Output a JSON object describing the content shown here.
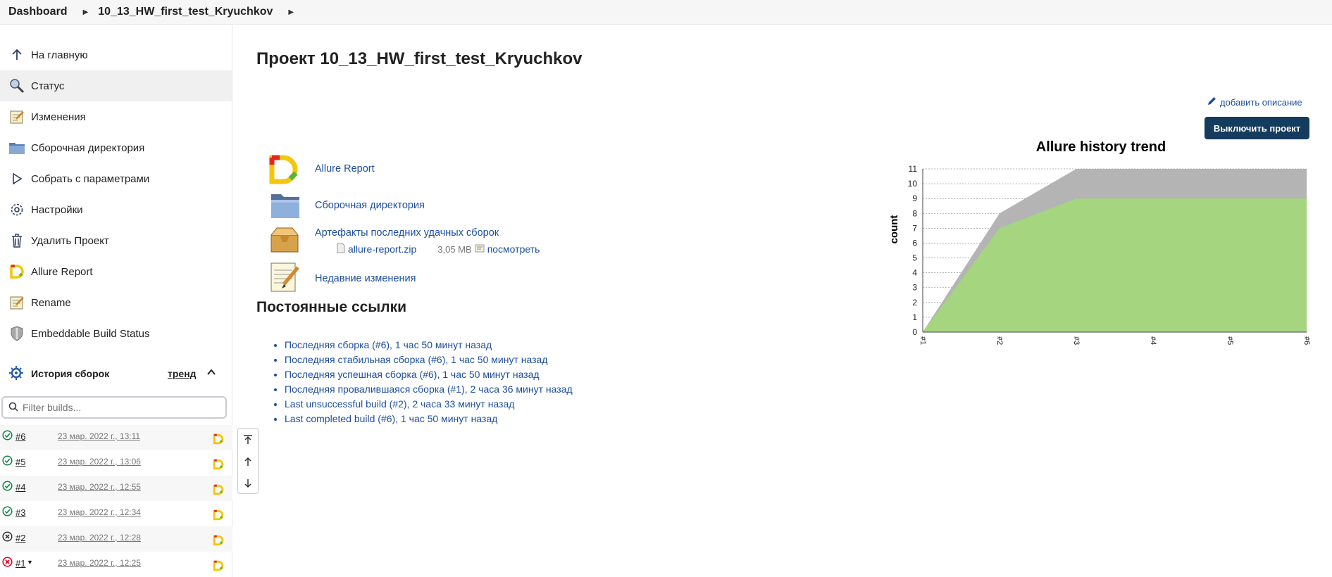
{
  "breadcrumb": {
    "root": "Dashboard",
    "project": "10_13_HW_first_test_Kryuchkov"
  },
  "sidebar": {
    "items": [
      {
        "label": "На главную",
        "icon": "arrow-up-icon"
      },
      {
        "label": "Статус",
        "icon": "magnifier-icon"
      },
      {
        "label": "Изменения",
        "icon": "notepad-icon"
      },
      {
        "label": "Сборочная директория",
        "icon": "folder-icon"
      },
      {
        "label": "Собрать с параметрами",
        "icon": "play-icon"
      },
      {
        "label": "Настройки",
        "icon": "gear-icon"
      },
      {
        "label": "Удалить Проект",
        "icon": "trash-icon"
      },
      {
        "label": "Allure Report",
        "icon": "allure-icon"
      },
      {
        "label": "Rename",
        "icon": "notepad-icon"
      },
      {
        "label": "Embeddable Build Status",
        "icon": "shield-icon"
      }
    ],
    "active_index": 1
  },
  "history": {
    "title": "История сборок",
    "trend": "тренд",
    "filter_placeholder": "Filter builds...",
    "builds": [
      {
        "num": "#6",
        "date": "23 мар. 2022 г., 13:11",
        "status": "success"
      },
      {
        "num": "#5",
        "date": "23 мар. 2022 г., 13:06",
        "status": "success"
      },
      {
        "num": "#4",
        "date": "23 мар. 2022 г., 12:55",
        "status": "success"
      },
      {
        "num": "#3",
        "date": "23 мар. 2022 г., 12:34",
        "status": "success"
      },
      {
        "num": "#2",
        "date": "23 мар. 2022 г., 12:28",
        "status": "aborted"
      },
      {
        "num": "#1",
        "date": "23 мар. 2022 г., 12:25",
        "status": "failed"
      }
    ]
  },
  "main": {
    "title": "Проект 10_13_HW_first_test_Kryuchkov",
    "add_description": "добавить описание",
    "disable_button": "Выключить проект",
    "links": {
      "allure": "Allure Report",
      "workspace": "Сборочная директория",
      "artifacts": "Артефакты последних удачных сборок",
      "artifact_file": "allure-report.zip",
      "artifact_size": "3,05 MB",
      "artifact_view": "посмотреть",
      "changes": "Недавние изменения"
    },
    "permalinks_title": "Постоянные ссылки",
    "permalinks": [
      "Последняя сборка (#6), 1 час 50 минут назад",
      "Последняя стабильная сборка (#6), 1 час 50 минут назад",
      "Последняя успешная сборка (#6), 1 час 50 минут назад",
      "Последняя провалившаяся сборка (#1), 2 часа 36 минут назад",
      "Last unsuccessful build (#2), 2 часа 33 минут назад",
      "Last completed build (#6), 1 час 50 минут назад"
    ]
  },
  "chart_data": {
    "type": "area",
    "title": "Allure history trend",
    "ylabel": "count",
    "xlabel": "",
    "categories": [
      "#1",
      "#2",
      "#3",
      "#4",
      "#5",
      "#6"
    ],
    "series": [
      {
        "values": [
          0,
          7,
          9,
          9,
          9,
          9
        ],
        "color": "#a5d57e"
      },
      {
        "values": [
          0,
          1,
          2,
          2,
          2,
          2
        ],
        "color": "#b4b4b4"
      }
    ],
    "ylim": [
      0,
      11
    ],
    "yticks": [
      0,
      1,
      2,
      3,
      4,
      5,
      6,
      7,
      8,
      9,
      10,
      11
    ],
    "stacked": true,
    "grid": true
  },
  "colors": {
    "link": "#1c4e9c",
    "button": "#153b5e",
    "success": "#138347",
    "failed": "#e6001f"
  }
}
